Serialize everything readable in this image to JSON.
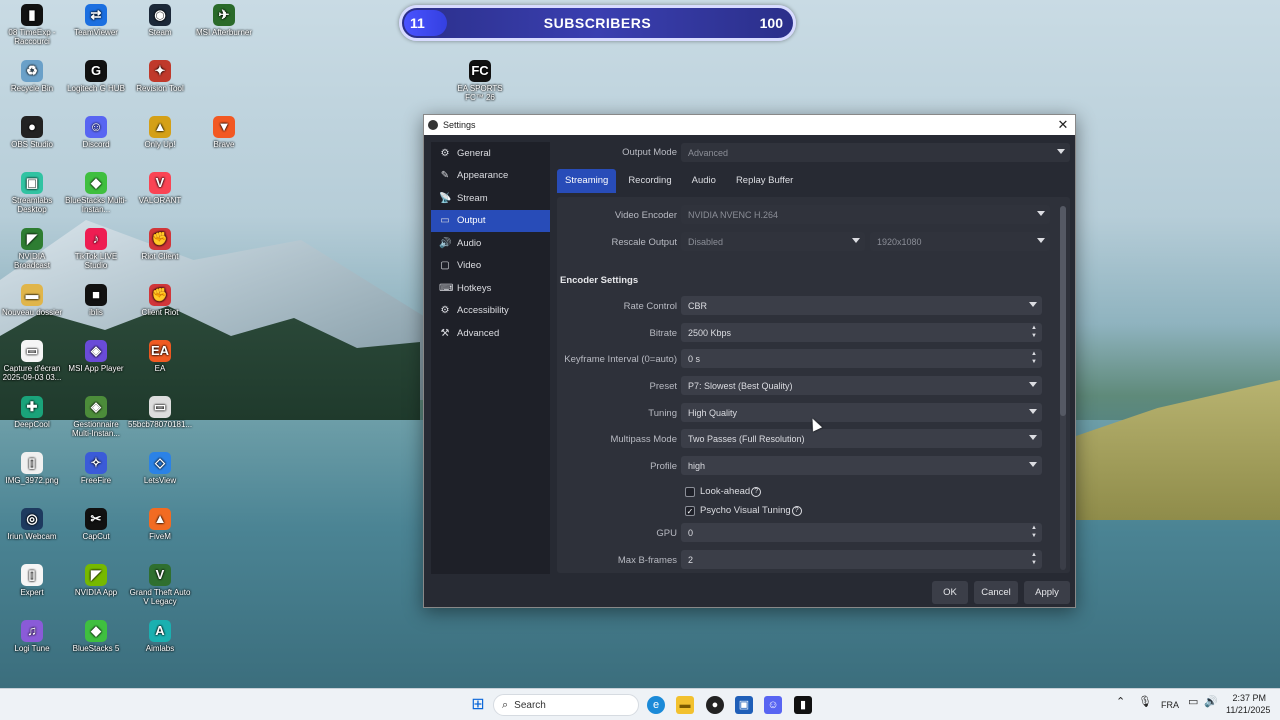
{
  "desktop": {
    "icons": [
      {
        "label": "08 TimeExp - Raccourci",
        "glyph": "▮",
        "color": "#111111"
      },
      {
        "label": "TeamViewer",
        "glyph": "⇄",
        "color": "#1b6fe0"
      },
      {
        "label": "Steam",
        "glyph": "◉",
        "color": "#1b2838"
      },
      {
        "label": "MSI Afterburner",
        "glyph": "✈",
        "color": "#2a6a2a"
      },
      {
        "label": "Recycle Bin",
        "glyph": "♻",
        "color": "#6aa0c8"
      },
      {
        "label": "Logitech G HUB",
        "glyph": "G",
        "color": "#111111"
      },
      {
        "label": "Revision Tool",
        "glyph": "✦",
        "color": "#c0392b"
      },
      {
        "label": "OBS Studio",
        "glyph": "●",
        "color": "#222222"
      },
      {
        "label": "Discord",
        "glyph": "☺",
        "color": "#5865f2"
      },
      {
        "label": "Only Up!",
        "glyph": "▲",
        "color": "#d4a017"
      },
      {
        "label": "Brave",
        "glyph": "▼",
        "color": "#f25822"
      },
      {
        "label": "Streamlabs Desktop",
        "glyph": "▣",
        "color": "#31c3a2"
      },
      {
        "label": "BlueStacks Multi-Instan...",
        "glyph": "◆",
        "color": "#3fbf3f"
      },
      {
        "label": "VALORANT",
        "glyph": "V",
        "color": "#fa4454"
      },
      {
        "label": "NVIDIA Broadcast",
        "glyph": "◤",
        "color": "#2e7d32"
      },
      {
        "label": "TikTok LIVE Studio",
        "glyph": "♪",
        "color": "#ee1d52"
      },
      {
        "label": "Riot Client",
        "glyph": "✊",
        "color": "#d13639"
      },
      {
        "label": "Nouveau dossier",
        "glyph": "▬",
        "color": "#e0b54a"
      },
      {
        "label": "iblis",
        "glyph": "■",
        "color": "#111111"
      },
      {
        "label": "Client Riot",
        "glyph": "✊",
        "color": "#d13639"
      },
      {
        "label": "Capture d'écran 2025-09-03 03...",
        "glyph": "▭",
        "color": "#f5f5f5"
      },
      {
        "label": "MSI App Player",
        "glyph": "◈",
        "color": "#6a4bd8"
      },
      {
        "label": "EA",
        "glyph": "EA",
        "color": "#f05a22"
      },
      {
        "label": "DeepCool",
        "glyph": "✚",
        "color": "#1aa37a"
      },
      {
        "label": "Gestionnaire Multi-Instan...",
        "glyph": "◈",
        "color": "#4c8c3a"
      },
      {
        "label": "55bcb78070181...",
        "glyph": "▭",
        "color": "#dddddd"
      },
      {
        "label": "IMG_3972.png",
        "glyph": "▯",
        "color": "#f0f0f0"
      },
      {
        "label": "FreeFire",
        "glyph": "✧",
        "color": "#3b5bd8"
      },
      {
        "label": "LetsView",
        "glyph": "◇",
        "color": "#2b82e6"
      },
      {
        "label": "Iriun Webcam",
        "glyph": "◎",
        "color": "#1e3a5f"
      },
      {
        "label": "CapCut",
        "glyph": "✂",
        "color": "#111111"
      },
      {
        "label": "FiveM",
        "glyph": "▲",
        "color": "#f26b22"
      },
      {
        "label": "Expert",
        "glyph": "▯",
        "color": "#f5f5f5"
      },
      {
        "label": "NVIDIA App",
        "glyph": "◤",
        "color": "#76b900"
      },
      {
        "label": "Grand Theft Auto V Legacy",
        "glyph": "V",
        "color": "#2f6f2f"
      },
      {
        "label": "Logi Tune",
        "glyph": "♫",
        "color": "#8a5bd8"
      },
      {
        "label": "BlueStacks 5",
        "glyph": "◆",
        "color": "#3fbf3f"
      },
      {
        "label": "Aimlabs",
        "glyph": "A",
        "color": "#1ab0b0"
      },
      {
        "label": "EA SPORTS FC™ 26",
        "glyph": "FC",
        "color": "#111111"
      }
    ]
  },
  "subscribers": {
    "current": "11",
    "title": "SUBSCRIBERS",
    "goal": "100",
    "progress_fraction": 0.11
  },
  "window": {
    "title": "Settings",
    "close_glyph": "✕"
  },
  "sidebar": {
    "items": [
      {
        "label": "General",
        "icon": "⚙"
      },
      {
        "label": "Appearance",
        "icon": "✎"
      },
      {
        "label": "Stream",
        "icon": "📡"
      },
      {
        "label": "Output",
        "icon": "▭"
      },
      {
        "label": "Audio",
        "icon": "🔊"
      },
      {
        "label": "Video",
        "icon": "▢"
      },
      {
        "label": "Hotkeys",
        "icon": "⌨"
      },
      {
        "label": "Accessibility",
        "icon": "⚙"
      },
      {
        "label": "Advanced",
        "icon": "⚒"
      }
    ],
    "active": "Output"
  },
  "output": {
    "mode_label": "Output Mode",
    "mode_value": "Advanced",
    "tabs": [
      "Streaming",
      "Recording",
      "Audio",
      "Replay Buffer"
    ],
    "active_tab": "Streaming",
    "video_encoder_label": "Video Encoder",
    "video_encoder_value": "NVIDIA NVENC H.264",
    "rescale_label": "Rescale Output",
    "rescale_value": "Disabled",
    "rescale_res": "1920x1080",
    "encoder_settings_header": "Encoder Settings",
    "fields": [
      {
        "label": "Rate Control",
        "value": "CBR",
        "kind": "dropdown"
      },
      {
        "label": "Bitrate",
        "value": "2500 Kbps",
        "kind": "spin"
      },
      {
        "label": "Keyframe Interval (0=auto)",
        "value": "0 s",
        "kind": "spin"
      },
      {
        "label": "Preset",
        "value": "P7: Slowest (Best Quality)",
        "kind": "dropdown"
      },
      {
        "label": "Tuning",
        "value": "High Quality",
        "kind": "dropdown"
      },
      {
        "label": "Multipass Mode",
        "value": "Two Passes (Full Resolution)",
        "kind": "dropdown"
      },
      {
        "label": "Profile",
        "value": "high",
        "kind": "dropdown"
      }
    ],
    "lookahead_label": "Look-ahead",
    "lookahead_checked": false,
    "psycho_label": "Psycho Visual Tuning",
    "psycho_checked": true,
    "gpu_label": "GPU",
    "gpu_value": "0",
    "bframes_label": "Max B-frames",
    "bframes_value": "2"
  },
  "buttons": {
    "ok": "OK",
    "cancel": "Cancel",
    "apply": "Apply"
  },
  "taskbar": {
    "search_placeholder": "Search",
    "lang": "FRA",
    "time": "2:37 PM",
    "date": "11/21/2025"
  }
}
